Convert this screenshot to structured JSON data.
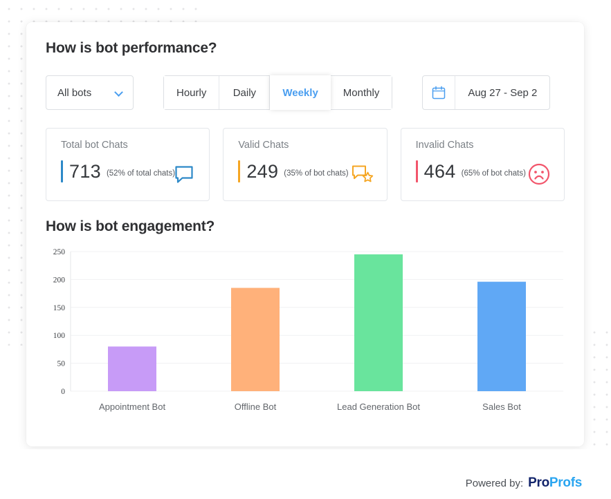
{
  "performance": {
    "title": "How is bot performance?",
    "bot_filter": {
      "selected": "All bots",
      "icon": "chevron-down-icon"
    },
    "granularity_tabs": [
      {
        "label": "Hourly",
        "active": false
      },
      {
        "label": "Daily",
        "active": false
      },
      {
        "label": "Weekly",
        "active": true
      },
      {
        "label": "Monthly",
        "active": false
      }
    ],
    "date_range": {
      "value": "Aug 27 - Sep 2",
      "icon": "calendar-icon"
    },
    "cards": [
      {
        "title": "Total bot Chats",
        "value": "713",
        "subtext": "(52% of total chats)",
        "accent": "#2d89c8",
        "icon": "chat-bubble-icon"
      },
      {
        "title": "Valid Chats",
        "value": "249",
        "subtext": "(35% of bot chats)",
        "accent": "#f5a623",
        "icon": "chat-bubble-star-icon"
      },
      {
        "title": "Invalid Chats",
        "value": "464",
        "subtext": "(65% of bot chats)",
        "accent": "#f2556b",
        "icon": "sad-face-icon"
      }
    ]
  },
  "engagement": {
    "title": "How is bot engagement?"
  },
  "chart_data": {
    "type": "bar",
    "title": "How is bot engagement?",
    "xlabel": "",
    "ylabel": "",
    "ylim": [
      0,
      250
    ],
    "yticks": [
      0,
      50,
      100,
      150,
      200,
      250
    ],
    "grid": true,
    "legend": "none",
    "categories": [
      "Appointment Bot",
      "Offline Bot",
      "Lead Generation Bot",
      "Sales Bot"
    ],
    "values": [
      80,
      185,
      245,
      196
    ],
    "colors": [
      "#c79bf7",
      "#ffb17a",
      "#69e49d",
      "#60a8f5"
    ]
  },
  "footer": {
    "powered_by": "Powered by:",
    "brand_first": "Pro",
    "brand_second": "Profs",
    "brand_first_color": "#12246b",
    "brand_second_color": "#2aa5f0"
  }
}
